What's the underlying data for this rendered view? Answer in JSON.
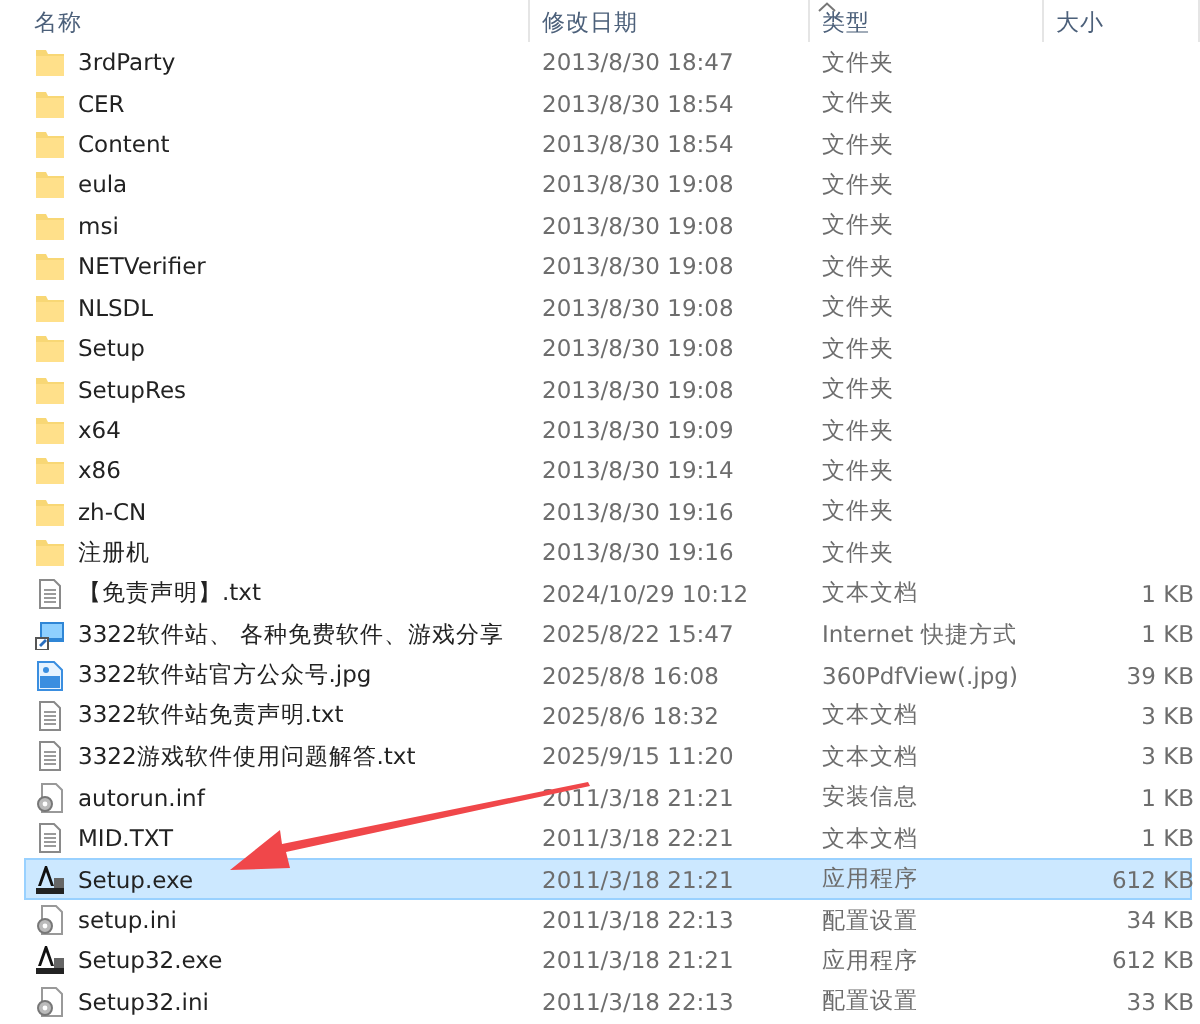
{
  "columns": [
    {
      "label": "名称",
      "sorted": false
    },
    {
      "label": "修改日期",
      "sorted": false
    },
    {
      "label": "类型",
      "sorted": true
    },
    {
      "label": "大小",
      "sorted": false
    }
  ],
  "rows": [
    {
      "kind": "folder",
      "name": "3rdParty",
      "date": "2013/8/30 18:47",
      "type": "文件夹",
      "selected": false
    },
    {
      "kind": "folder",
      "name": "CER",
      "date": "2013/8/30 18:54",
      "type": "文件夹",
      "selected": false
    },
    {
      "kind": "folder",
      "name": "Content",
      "date": "2013/8/30 18:54",
      "type": "文件夹",
      "selected": false
    },
    {
      "kind": "folder",
      "name": "eula",
      "date": "2013/8/30 19:08",
      "type": "文件夹",
      "selected": false
    },
    {
      "kind": "folder",
      "name": "msi",
      "date": "2013/8/30 19:08",
      "type": "文件夹",
      "selected": false
    },
    {
      "kind": "folder",
      "name": "NETVerifier",
      "date": "2013/8/30 19:08",
      "type": "文件夹",
      "selected": false
    },
    {
      "kind": "folder",
      "name": "NLSDL",
      "date": "2013/8/30 19:08",
      "type": "文件夹",
      "selected": false
    },
    {
      "kind": "folder",
      "name": "Setup",
      "date": "2013/8/30 19:08",
      "type": "文件夹",
      "selected": false
    },
    {
      "kind": "folder",
      "name": "SetupRes",
      "date": "2013/8/30 19:08",
      "type": "文件夹",
      "selected": false
    },
    {
      "kind": "folder",
      "name": "x64",
      "date": "2013/8/30 19:09",
      "type": "文件夹",
      "selected": false
    },
    {
      "kind": "folder",
      "name": "x86",
      "date": "2013/8/30 19:14",
      "type": "文件夹",
      "selected": false
    },
    {
      "kind": "folder",
      "name": "zh-CN",
      "date": "2013/8/30 19:16",
      "type": "文件夹",
      "selected": false
    },
    {
      "kind": "folder",
      "name": "注册机",
      "date": "2013/8/30 19:16",
      "type": "文件夹",
      "selected": false
    },
    {
      "kind": "text",
      "name": "【免责声明】.txt",
      "date": "2024/10/29 10:12",
      "type": "文本文档",
      "size": "1 KB",
      "selected": false
    },
    {
      "kind": "shortcut",
      "name": "3322软件站、 各种免费软件、游戏分享",
      "date": "2025/8/22 15:47",
      "type": "Internet 快捷方式",
      "size": "1 KB",
      "selected": false
    },
    {
      "kind": "image",
      "name": "3322软件站官方公众号.jpg",
      "date": "2025/8/8 16:08",
      "type": "360PdfView(.jpg)",
      "size": "39 KB",
      "selected": false
    },
    {
      "kind": "text",
      "name": "3322软件站免责声明.txt",
      "date": "2025/8/6 18:32",
      "type": "文本文档",
      "size": "3 KB",
      "selected": false
    },
    {
      "kind": "text",
      "name": "3322游戏软件使用问题解答.txt",
      "date": "2025/9/15 11:20",
      "type": "文本文档",
      "size": "3 KB",
      "selected": false
    },
    {
      "kind": "settings",
      "name": "autorun.inf",
      "date": "2011/3/18 21:21",
      "type": "安装信息",
      "size": "1 KB",
      "selected": false
    },
    {
      "kind": "text",
      "name": "MID.TXT",
      "date": "2011/3/18 22:21",
      "type": "文本文档",
      "size": "1 KB",
      "selected": false
    },
    {
      "kind": "program",
      "name": "Setup.exe",
      "date": "2011/3/18 21:21",
      "type": "应用程序",
      "size": "612 KB",
      "selected": true
    },
    {
      "kind": "settings",
      "name": "setup.ini",
      "date": "2011/3/18 22:13",
      "type": "配置设置",
      "size": "34 KB",
      "selected": false
    },
    {
      "kind": "program",
      "name": "Setup32.exe",
      "date": "2011/3/18 21:21",
      "type": "应用程序",
      "size": "612 KB",
      "selected": false
    },
    {
      "kind": "settings",
      "name": "Setup32.ini",
      "date": "2011/3/18 22:13",
      "type": "配置设置",
      "size": "33 KB",
      "selected": false
    }
  ]
}
